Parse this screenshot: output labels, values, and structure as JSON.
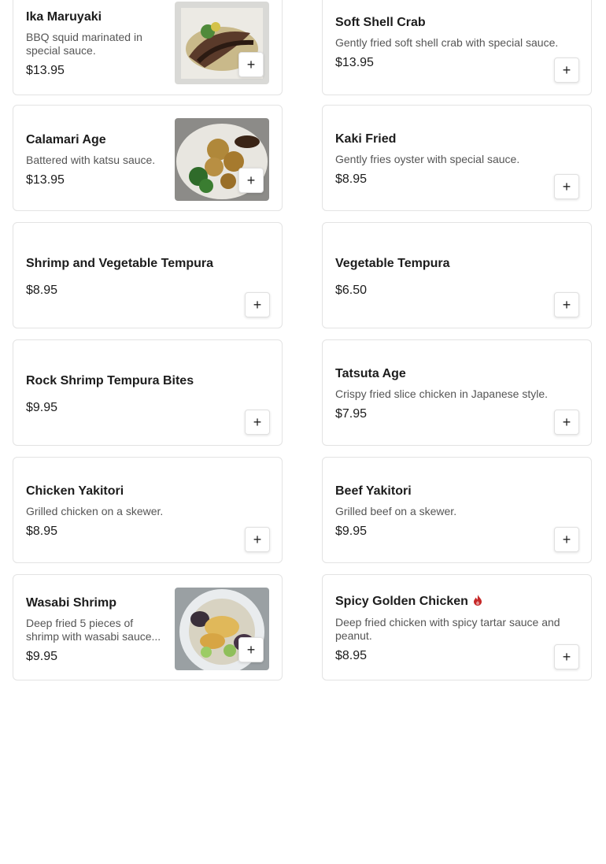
{
  "items": [
    {
      "name": "Ika Maruyaki",
      "desc": "BBQ squid marinated in special sauce.",
      "price": "$13.95"
    },
    {
      "name": "Soft Shell Crab",
      "desc": "Gently fried soft shell crab with special sauce.",
      "price": "$13.95"
    },
    {
      "name": "Calamari Age",
      "desc": "Battered with katsu sauce.",
      "price": "$13.95"
    },
    {
      "name": "Kaki Fried",
      "desc": "Gently fries oyster with special sauce.",
      "price": "$8.95"
    },
    {
      "name": "Shrimp and Vegetable Tempura",
      "desc": "",
      "price": "$8.95"
    },
    {
      "name": "Vegetable Tempura",
      "desc": "",
      "price": "$6.50"
    },
    {
      "name": "Rock Shrimp Tempura Bites",
      "desc": "",
      "price": "$9.95"
    },
    {
      "name": "Tatsuta Age",
      "desc": "Crispy fried slice chicken in Japanese style.",
      "price": "$7.95"
    },
    {
      "name": "Chicken Yakitori",
      "desc": "Grilled chicken on a skewer.",
      "price": "$8.95"
    },
    {
      "name": "Beef Yakitori",
      "desc": "Grilled beef on a skewer.",
      "price": "$9.95"
    },
    {
      "name": "Wasabi Shrimp",
      "desc": "Deep fried 5 pieces of shrimp with wasabi sauce...",
      "price": "$9.95"
    },
    {
      "name": "Spicy Golden Chicken",
      "desc": "Deep fried chicken with spicy tartar sauce and peanut.",
      "price": "$8.95"
    }
  ],
  "add_label": "+",
  "colors": {
    "spicy": "#c62828",
    "border": "#e3e3e3"
  },
  "icons": {
    "add": "plus-icon",
    "spicy": "flame-icon"
  }
}
